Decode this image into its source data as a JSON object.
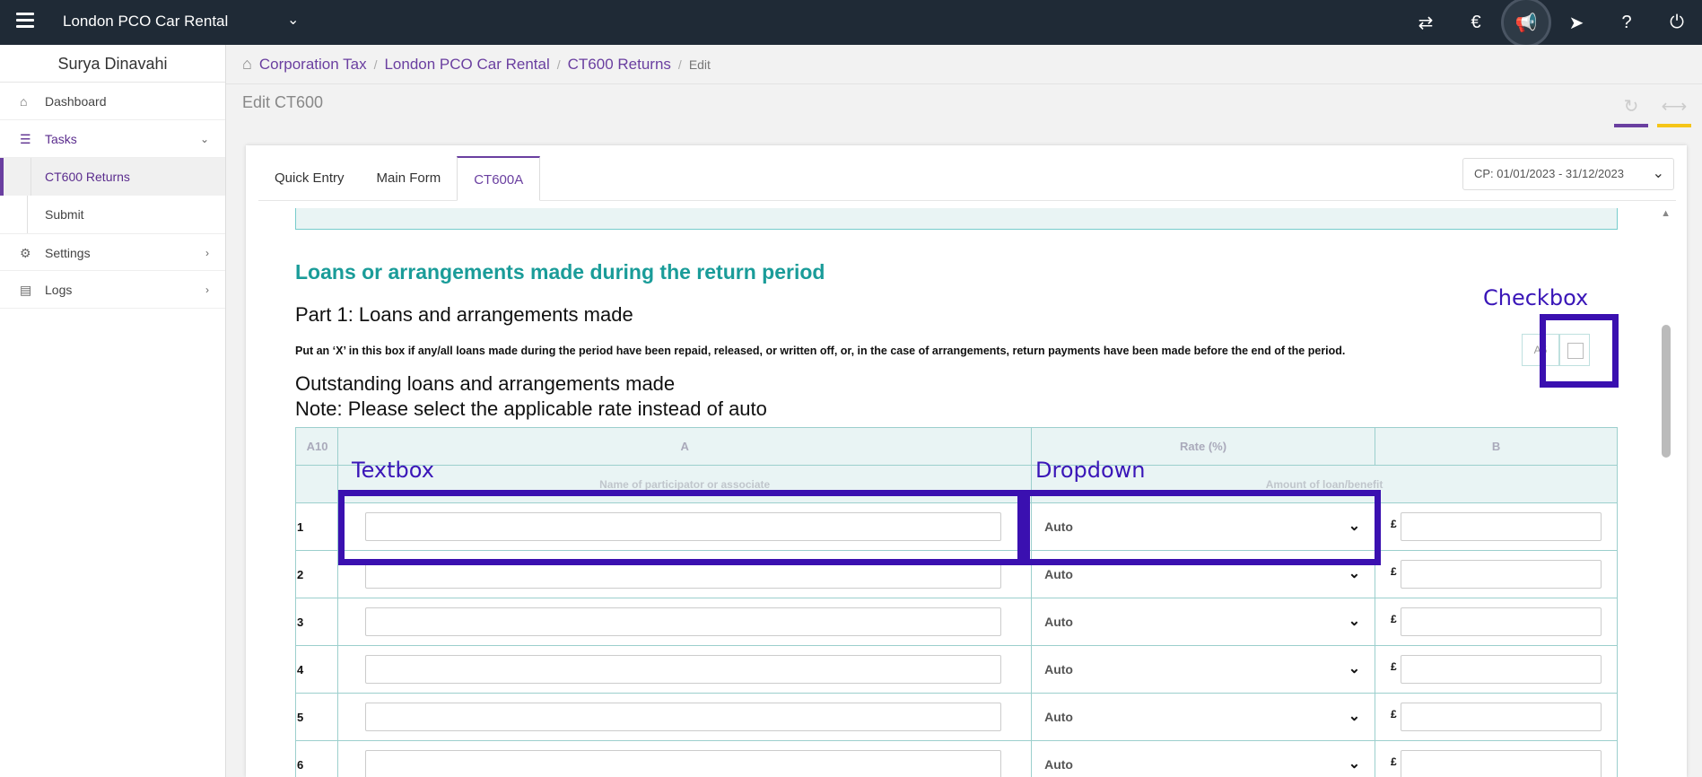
{
  "topbar": {
    "company": "London PCO Car Rental",
    "icons": [
      "switch-icon",
      "currency-icon",
      "megaphone-icon",
      "ticket-icon",
      "help-icon",
      "power-icon"
    ]
  },
  "sidebar": {
    "user": "Surya Dinavahi",
    "items": [
      {
        "label": "Dashboard",
        "icon": "home-icon"
      },
      {
        "label": "Tasks",
        "icon": "tasks-icon"
      },
      {
        "label": "Settings",
        "icon": "gear-icon"
      },
      {
        "label": "Logs",
        "icon": "document-icon"
      }
    ],
    "subitems": [
      {
        "label": "CT600 Returns"
      },
      {
        "label": "Submit"
      }
    ]
  },
  "breadcrumb": {
    "items": [
      "Corporation Tax",
      "London PCO Car Rental",
      "CT600 Returns"
    ],
    "current": "Edit"
  },
  "page": {
    "title": "Edit CT600"
  },
  "tabs": [
    "Quick Entry",
    "Main Form",
    "CT600A"
  ],
  "period": "CP: 01/01/2023 - 31/12/2023",
  "form": {
    "section_title": "Loans or arrangements made during the return period",
    "part_title": "Part 1: Loans and arrangements made",
    "instruction": "Put an ‘X’ in this box if any/all loans made during the period have been repaid, released, or written off, or, in the case of arrangements, return payments have been made before the end of the period.",
    "box_code": "A5",
    "outstanding": "Outstanding loans and arrangements made",
    "note": "Note: Please select the applicable rate instead of auto"
  },
  "table": {
    "headers": [
      "A10",
      "A",
      "Rate (%)",
      "B"
    ],
    "subheaders": [
      "",
      "Name of participator or associate",
      "",
      "Amount of loan/benefit"
    ],
    "rows": [
      {
        "num": "1",
        "rate": "Auto"
      },
      {
        "num": "2",
        "rate": "Auto"
      },
      {
        "num": "3",
        "rate": "Auto"
      },
      {
        "num": "4",
        "rate": "Auto"
      },
      {
        "num": "5",
        "rate": "Auto"
      },
      {
        "num": "6",
        "rate": "Auto"
      }
    ],
    "currency": "£"
  },
  "annotations": {
    "checkbox": "Checkbox",
    "textbox": "Textbox",
    "dropdown": "Dropdown",
    "color": "#3a10b0"
  }
}
